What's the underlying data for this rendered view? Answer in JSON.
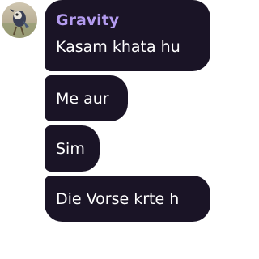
{
  "chat": {
    "sender_name": "Gravity",
    "colors": {
      "bubble": "#1a1426",
      "sender_name": "#b49cf0",
      "message_text": "#ffffff",
      "background": "#ffffff"
    },
    "messages": [
      {
        "text": "Kasam khata hu"
      },
      {
        "text": "Me aur"
      },
      {
        "text": "Sim"
      },
      {
        "text": "Die Vorse krte h"
      }
    ]
  }
}
